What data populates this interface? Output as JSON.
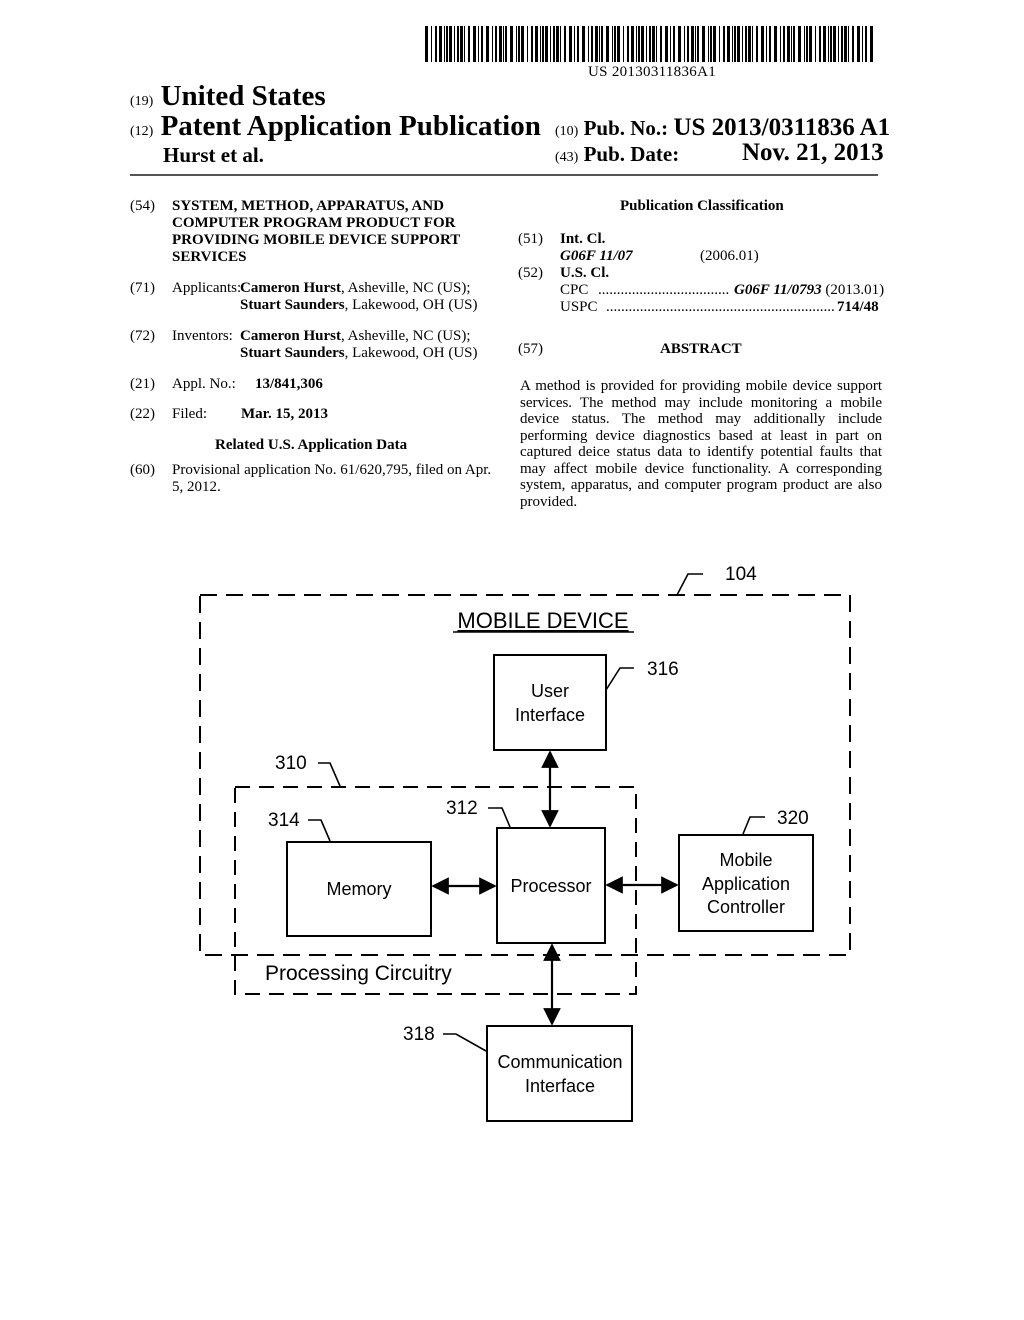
{
  "barcode": {
    "number": "US 20130311836A1"
  },
  "header": {
    "country_code": "(19)",
    "country": "United States",
    "type_code": "(12)",
    "type": "Patent Application Publication",
    "author": "Hurst et al.",
    "pub_no_code": "(10)",
    "pub_no_label": "Pub. No.:",
    "pub_no": "US 2013/0311836 A1",
    "pub_date_code": "(43)",
    "pub_date_label": "Pub. Date:",
    "pub_date": "Nov. 21, 2013"
  },
  "left": {
    "title_code": "(54)",
    "title_lines": [
      "SYSTEM, METHOD, APPARATUS, AND",
      "COMPUTER PROGRAM PRODUCT FOR",
      "PROVIDING MOBILE DEVICE SUPPORT",
      "SERVICES"
    ],
    "applicants_code": "(71)",
    "applicants_label": "Applicants:",
    "applicants": [
      {
        "name": "Cameron Hurst",
        "location": ", Asheville, NC (US);"
      },
      {
        "name": "Stuart Saunders",
        "location": ", Lakewood, OH (US)"
      }
    ],
    "inventors_code": "(72)",
    "inventors_label": "Inventors:",
    "inventors": [
      {
        "name": "Cameron Hurst",
        "location": ", Asheville, NC (US);"
      },
      {
        "name": "Stuart Saunders",
        "location": ", Lakewood, OH (US)"
      }
    ],
    "appl_code": "(21)",
    "appl_label": "Appl. No.:",
    "appl_no": "13/841,306",
    "filed_code": "(22)",
    "filed_label": "Filed:",
    "filed_date": "Mar. 15, 2013",
    "related_heading": "Related U.S. Application Data",
    "provisional_code": "(60)",
    "provisional_lines": [
      "Provisional application No. 61/620,795, filed on Apr.",
      "5, 2012."
    ]
  },
  "right": {
    "pub_class_heading": "Publication Classification",
    "int_cl_code": "(51)",
    "int_cl_label": "Int. Cl.",
    "int_cl_class": "G06F 11/07",
    "int_cl_version": "(2006.01)",
    "us_cl_code": "(52)",
    "us_cl_label": "U.S. Cl.",
    "cpc_label": "CPC",
    "cpc_class": "G06F 11/0793",
    "cpc_version": "(2013.01)",
    "uspc_label": "USPC",
    "uspc_class": "714/48",
    "abstract_code": "(57)",
    "abstract_heading": "ABSTRACT",
    "abstract_text": "A method is provided for providing mobile device support services. The method may include monitoring a mobile device status. The method may additionally include performing device diagnostics based at least in part on captured deice status data to identify potential faults that may affect mobile device functionality. A corresponding system, apparatus, and computer program product are also provided."
  },
  "diagram": {
    "outer_ref": "104",
    "outer_title": "MOBILE DEVICE",
    "user_interface": {
      "ref": "316",
      "lines": [
        "User",
        "Interface"
      ]
    },
    "processing_circuitry": {
      "ref": "310",
      "label": "Processing Circuitry"
    },
    "processor": {
      "ref": "312",
      "label": "Processor"
    },
    "memory": {
      "ref": "314",
      "label": "Memory"
    },
    "mobile_app_controller": {
      "ref": "320",
      "lines": [
        "Mobile",
        "Application",
        "Controller"
      ]
    },
    "communication_interface": {
      "ref": "318",
      "lines": [
        "Communication",
        "Interface"
      ]
    }
  }
}
